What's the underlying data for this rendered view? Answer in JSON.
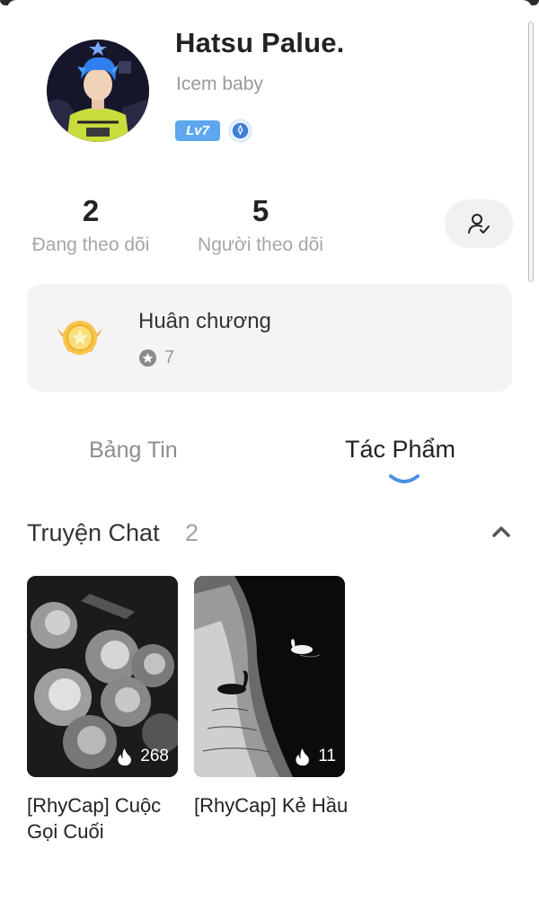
{
  "profile": {
    "name": "Hatsu Palue.",
    "bio": "Icem baby",
    "level": "Lv7"
  },
  "stats": {
    "following_count": "2",
    "following_label": "Đang theo dõi",
    "followers_count": "5",
    "followers_label": "Người theo dõi"
  },
  "medals": {
    "title": "Huân chương",
    "count": "7"
  },
  "tabs": [
    {
      "label": "Bảng Tin",
      "active": false
    },
    {
      "label": "Tác Phẩm",
      "active": true
    }
  ],
  "section": {
    "title": "Truyện Chat",
    "count": "2"
  },
  "stories": [
    {
      "title": "[RhyCap] Cuộc Gọi Cuối",
      "views": "268"
    },
    {
      "title": "[RhyCap] Kẻ Hầu",
      "views": "11"
    }
  ],
  "colors": {
    "accent": "#4a90e2",
    "level_badge": "#5ea6ee",
    "card_bg": "#f4f4f4",
    "medal_gold": "#f5c542"
  }
}
